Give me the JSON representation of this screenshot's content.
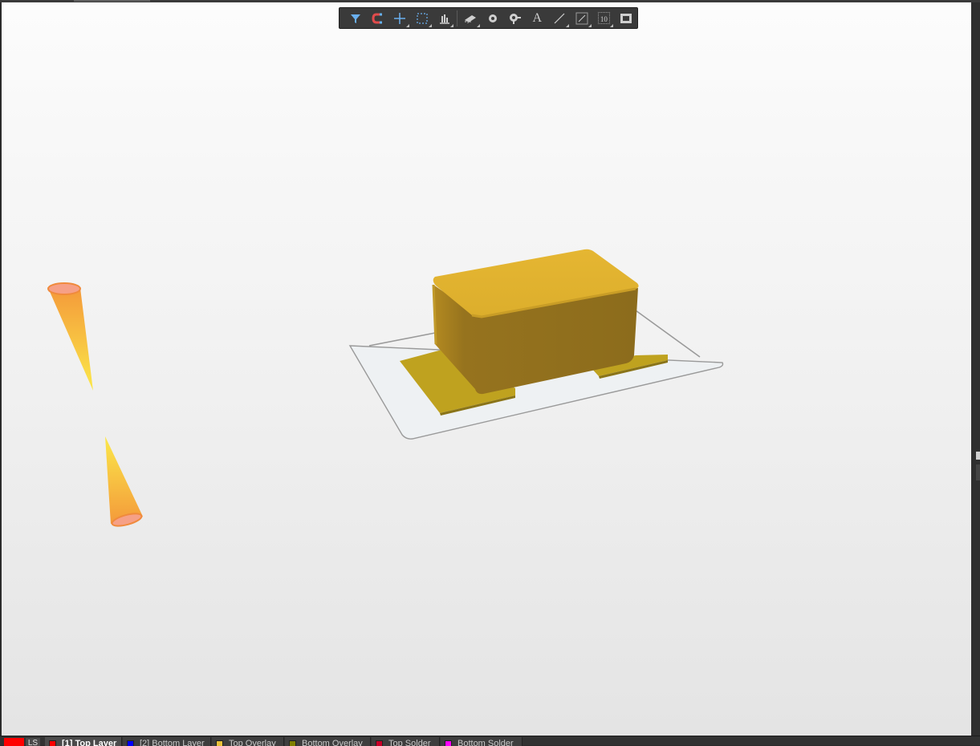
{
  "toolbar": {
    "tools": [
      {
        "icon": "filter-icon",
        "has_menu": false
      },
      {
        "icon": "magnet-icon",
        "has_menu": false
      },
      {
        "icon": "crosshair-icon",
        "has_menu": true
      },
      {
        "icon": "selection-rectangle-icon",
        "has_menu": true
      },
      {
        "icon": "align-icon",
        "has_menu": true
      },
      {
        "icon": "component-icon",
        "has_menu": true
      },
      {
        "icon": "via-icon",
        "has_menu": false
      },
      {
        "icon": "pad-icon",
        "has_menu": false
      },
      {
        "icon": "text-icon",
        "has_menu": false
      },
      {
        "icon": "line-icon",
        "has_menu": true
      },
      {
        "icon": "dimension-icon",
        "has_menu": true
      },
      {
        "icon": "designator-icon",
        "has_menu": true
      },
      {
        "icon": "region-icon",
        "has_menu": false
      }
    ],
    "text_icon_glyph": "A",
    "designator_glyph": "10"
  },
  "layers": {
    "current_color": "#ff0000",
    "ls_label": "LS",
    "tabs": [
      {
        "label": "[1] Top Layer",
        "color": "#ff0000",
        "active": true
      },
      {
        "label": "[2] Bottom Layer",
        "color": "#0000ff",
        "active": false
      },
      {
        "label": "Top Overlay",
        "color": "#e8c039",
        "active": false
      },
      {
        "label": "Bottom Overlay",
        "color": "#808000",
        "active": false
      },
      {
        "label": "Top Solder",
        "color": "#c80028",
        "active": false
      },
      {
        "label": "Bottom Solder",
        "color": "#ff00ff",
        "active": false
      }
    ]
  },
  "scene_colors": {
    "component_body": "#e2b431",
    "pad": "#bfa21f",
    "board": "#eef1f3",
    "gizmo": "#f4a43a"
  }
}
